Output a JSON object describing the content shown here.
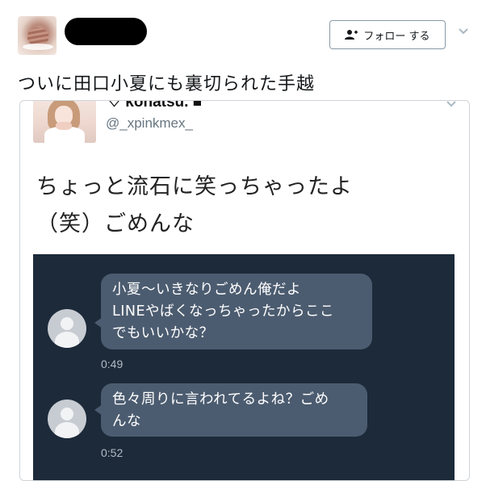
{
  "tweet": {
    "author_avatar": "cake-photo-avatar",
    "author_name_redacted": true,
    "follow_button": {
      "label": "フォロー する",
      "icon": "add-user-icon"
    },
    "menu_icon": "chevron-down-icon",
    "text": "ついに田口小夏にも裏切られた手越"
  },
  "embedded_tweet": {
    "name": "♡ konatsu. ■",
    "handle": "@_xpinkmex_",
    "menu_icon": "chevron-down-icon",
    "text_line1": "ちょっと流石に笑っちゃったよ",
    "text_line2": "（笑）ごめんな",
    "chat": {
      "background": "#1c2a3a",
      "bubble_color": "#4c5c70",
      "messages": [
        {
          "lines": [
            "小夏〜いきなりごめん俺だよ",
            "LINEやばくなっちゃったからここ",
            "でもいいかな？"
          ],
          "time": "0:49"
        },
        {
          "lines": [
            "色々周りに言われてるよね？ごめ",
            "んな"
          ],
          "time": "0:52"
        }
      ]
    }
  }
}
